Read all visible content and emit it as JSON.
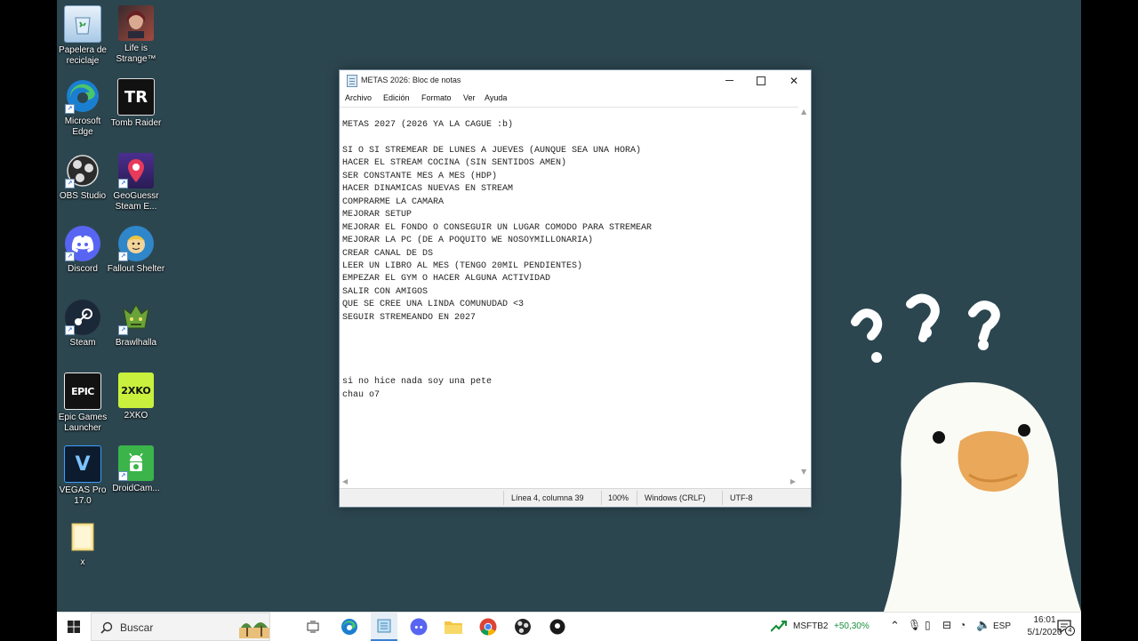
{
  "desktop_icons": [
    {
      "name": "recycle-bin",
      "label": "Papelera de reciclaje",
      "color": "#9fc4e4"
    },
    {
      "name": "life-is-strange",
      "label": "Life is Strange™",
      "color": "#7b3e36"
    },
    {
      "name": "microsoft-edge",
      "label": "Microsoft Edge",
      "color": "#1f8fd6"
    },
    {
      "name": "tomb-raider",
      "label": "Tomb Raider",
      "color": "#111111",
      "glyph": "TR"
    },
    {
      "name": "obs-studio",
      "label": "OBS Studio",
      "color": "#2b2b2b"
    },
    {
      "name": "geoguessr",
      "label": "GeoGuessr Steam E...",
      "color": "#3a2a6e"
    },
    {
      "name": "discord",
      "label": "Discord",
      "color": "#5865f2"
    },
    {
      "name": "fallout-shelter",
      "label": "Fallout Shelter",
      "color": "#2f86c9"
    },
    {
      "name": "steam",
      "label": "Steam",
      "color": "#1b2838"
    },
    {
      "name": "brawlhalla",
      "label": "Brawlhalla",
      "color": "#5a7a2a"
    },
    {
      "name": "epic-games",
      "label": "Epic Games Launcher",
      "color": "#121212",
      "glyph": "EPIC"
    },
    {
      "name": "2xko",
      "label": "2XKO",
      "color": "#c8f03c",
      "glyph": "2XKO"
    },
    {
      "name": "vegas-pro",
      "label": "VEGAS Pro 17.0",
      "color": "#0d1b2e",
      "glyph": "V"
    },
    {
      "name": "droidcam",
      "label": "DroidCam...",
      "color": "#3bb54a"
    },
    {
      "name": "folder-x",
      "label": "x",
      "color": "#f4d77a"
    }
  ],
  "notepad": {
    "title": "METAS 2026: Bloc de notas",
    "menu": [
      "Archivo",
      "Edición",
      "Formato",
      "Ver",
      "Ayuda"
    ],
    "text": "METAS 2027 (2026 YA LA CAGUE :b)\n\nSI O SI STREMEAR DE LUNES A JUEVES (AUNQUE SEA UNA HORA)\nHACER EL STREAM COCINA (SIN SENTIDOS AMEN)\nSER CONSTANTE MES A MES (HDP)\nHACER DINAMICAS NUEVAS EN STREAM\nCOMPRARME LA CAMARA\nMEJORAR SETUP\nMEJORAR EL FONDO O CONSEGUIR UN LUGAR COMODO PARA STREMEAR\nMEJORAR LA PC (DE A POQUITO WE NOSOYMILLONARIA)\nCREAR CANAL DE DS\nLEER UN LIBRO AL MES (TENGO 20MIL PENDIENTES)\nEMPEZAR EL GYM O HACER ALGUNA ACTIVIDAD\nSALIR CON AMIGOS\nQUE SE CREE UNA LINDA COMUNUDAD <3\nSEGUIR STREMEANDO EN 2027\n\n\n\n\nsi no hice nada soy una pete\nchau o7",
    "status": {
      "position": "Línea 4, columna 39",
      "zoom": "100%",
      "line_ending": "Windows (CRLF)",
      "encoding": "UTF-8"
    }
  },
  "taskbar": {
    "search_placeholder": "Buscar",
    "stock_ticker": "MSFTB2",
    "stock_change": "+50,30%",
    "stock_color": "#1a8f3c",
    "language": "ESP",
    "time": "16:01",
    "date": "5/1/2026",
    "notification_count": "4"
  }
}
